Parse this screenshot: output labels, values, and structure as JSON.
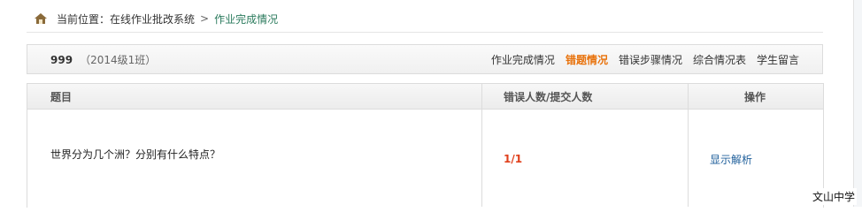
{
  "breadcrumb": {
    "label": "当前位置：在线作业批改系统",
    "separator": ">",
    "current": "作业完成情况",
    "icon": "home-icon"
  },
  "header": {
    "hw_number": "999",
    "class_name": "（2014级1班）",
    "tabs": [
      {
        "label": "作业完成情况",
        "active": false
      },
      {
        "label": "错题情况",
        "active": true
      },
      {
        "label": "错误步骤情况",
        "active": false
      },
      {
        "label": "综合情况表",
        "active": false
      },
      {
        "label": "学生留言",
        "active": false
      }
    ]
  },
  "table": {
    "columns": [
      "题目",
      "错误人数/提交人数",
      "操作"
    ],
    "rows": [
      {
        "question": "世界分为几个洲？分别有什么特点？",
        "ratio": "1/1",
        "action": "显示解析"
      }
    ]
  },
  "footer": {
    "school": "文山中学"
  },
  "colors": {
    "accent": "#e8720c",
    "ratio": "#e0401c",
    "link": "#1f5f9b",
    "crumb_current": "#2a7a5c"
  }
}
